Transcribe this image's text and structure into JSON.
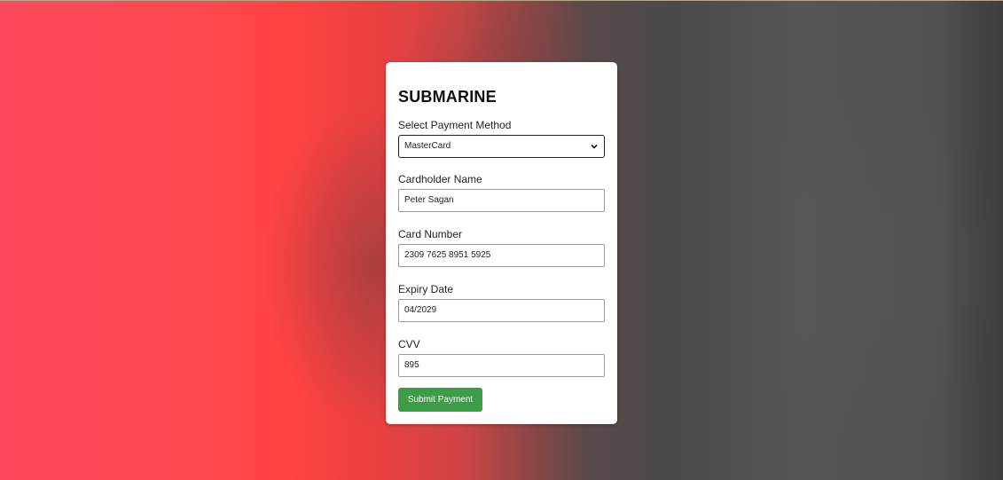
{
  "form": {
    "title": "SUBMARINE",
    "payment_method": {
      "label": "Select Payment Method",
      "selected": "MasterCard"
    },
    "cardholder_name": {
      "label": "Cardholder Name",
      "value": "Peter Sagan"
    },
    "card_number": {
      "label": "Card Number",
      "value": "2309 7625 8951 5925"
    },
    "expiry_date": {
      "label": "Expiry Date",
      "value": "04/2029"
    },
    "cvv": {
      "label": "CVV",
      "value": "895"
    },
    "submit_label": "Submit Payment"
  },
  "colors": {
    "submit_button": "#3d9c46",
    "background_left": "#ff4a5e",
    "background_right": "#4a4a4a"
  },
  "icons": {
    "select": "chevron-down-icon"
  }
}
